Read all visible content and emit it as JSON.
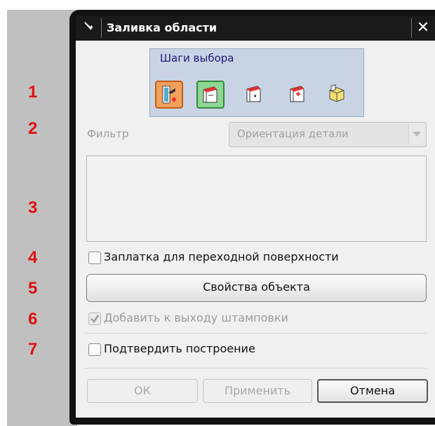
{
  "window": {
    "title": "Заливка области",
    "close_glyph": "✕"
  },
  "selection_steps": {
    "label": "Шаги выбора",
    "icons": [
      "region-seed-icon",
      "boundary-face-icon",
      "face-arrow-icon",
      "face-plus-icon",
      "solid-body-icon"
    ]
  },
  "row_numbers": [
    "1",
    "2",
    "3",
    "4",
    "5",
    "6",
    "7"
  ],
  "filter": {
    "label": "Фильтр",
    "value": "Ориентация детали"
  },
  "options": {
    "patch_blend": {
      "label": "Заплатка для переходной поверхности",
      "checked": false,
      "enabled": true
    },
    "properties_button": "Свойства объекта",
    "add_to_stamp": {
      "label": "Добавить к выходу штамповки",
      "checked": true,
      "enabled": false
    },
    "confirm": {
      "label": "Подтвердить построение",
      "checked": false,
      "enabled": true
    }
  },
  "buttons": {
    "ok": "ОК",
    "apply": "Применить",
    "cancel": "Отмена"
  },
  "colors": {
    "accent_number": "#e01010",
    "step_selected": "#f3a05a",
    "step_selected_2": "#8fd694"
  }
}
